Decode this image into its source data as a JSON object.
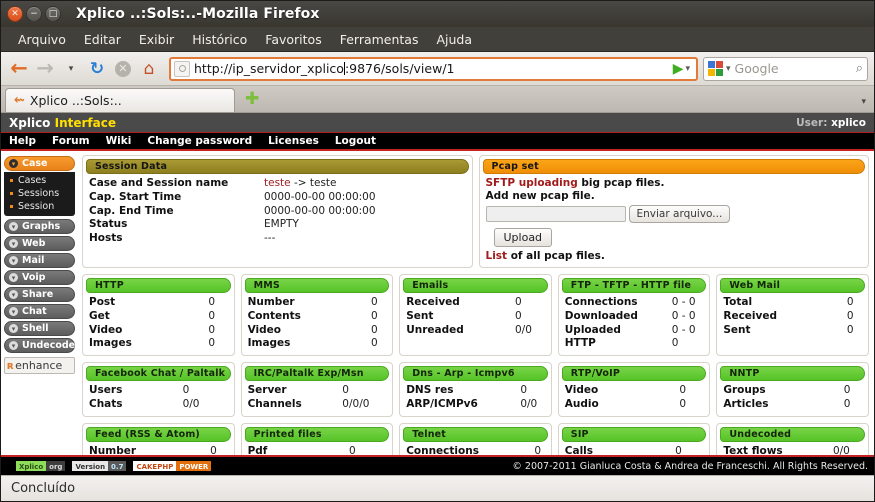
{
  "window": {
    "title": "Xplico ..:Sols:..-Mozilla Firefox",
    "close_glyph": "✕",
    "minimize_glyph": "−",
    "maximize_glyph": "□"
  },
  "menubar": [
    {
      "label": "Arquivo",
      "accel": "A"
    },
    {
      "label": "Editar",
      "accel": "E"
    },
    {
      "label": "Exibir",
      "accel": "x"
    },
    {
      "label": "Histórico",
      "accel": "H"
    },
    {
      "label": "Favoritos",
      "accel": "v"
    },
    {
      "label": "Ferramentas",
      "accel": "F"
    },
    {
      "label": "Ajuda",
      "accel": "u"
    }
  ],
  "toolbar": {
    "back_icon": "back-arrow-icon",
    "forward_icon": "forward-arrow-icon",
    "history_caret": "▾",
    "reload_glyph": "↻",
    "stop_glyph": "✕",
    "home_glyph": "⌂",
    "url": "http://ip_servidor_xplico:9876/sols/view/1",
    "url_before_caret": "http://ip_servidor_xplico",
    "url_after_caret": ":9876/sols/view/1",
    "go_glyph": "▶",
    "url_caret": "▾",
    "search_placeholder": "Google",
    "search_caret": "▾",
    "search_glyph": "⌕"
  },
  "tabbar": {
    "tab_label": "Xplico ..:Sols:..",
    "tab_icon_glyph": "✆",
    "new_tab_glyph": "✚",
    "list_caret": "▾"
  },
  "xplico": {
    "logo_main": "Xplico",
    "logo_accent": "Interface",
    "user_label": "User:",
    "user_name": "xplico",
    "menu": [
      "Help",
      "Forum",
      "Wiki",
      "Change password",
      "Licenses",
      "Logout"
    ]
  },
  "sidebar": {
    "case_group": {
      "label": "Case",
      "bullet": "▾",
      "items": [
        "Cases",
        "Sessions",
        "Session"
      ]
    },
    "items": [
      {
        "label": "Graphs",
        "bullet": "▾"
      },
      {
        "label": "Web",
        "bullet": "▾"
      },
      {
        "label": "Mail",
        "bullet": "▾"
      },
      {
        "label": "Voip",
        "bullet": "▾"
      },
      {
        "label": "Share",
        "bullet": "▾"
      },
      {
        "label": "Chat",
        "bullet": "▾"
      },
      {
        "label": "Shell",
        "bullet": "▾"
      },
      {
        "label": "Undecoded",
        "bullet": "▾"
      }
    ],
    "enhance": {
      "icon": "ʀ",
      "label": "enhance"
    }
  },
  "session_data": {
    "title": "Session Data",
    "rows": [
      {
        "key": "Case and Session name",
        "value": "teste -> teste",
        "value_prefix": "teste",
        "value_suffix": " -> teste"
      },
      {
        "key": "Cap. Start Time",
        "value": "0000-00-00 00:00:00"
      },
      {
        "key": "Cap. End Time",
        "value": "0000-00-00 00:00:00"
      },
      {
        "key": "Status",
        "value": "EMPTY"
      },
      {
        "key": "Hosts",
        "value": "---"
      }
    ]
  },
  "pcap_set": {
    "title": "Pcap set",
    "line1_link": "SFTP uploading",
    "line1_rest": " big pcap files.",
    "line2": "Add new pcap file.",
    "file_button": "Enviar arquivo...",
    "upload_button": "Upload",
    "line3_link": "List",
    "line3_rest": " of all pcap files."
  },
  "panels": [
    {
      "title": "HTTP",
      "rows": [
        {
          "key": "Post",
          "value": "0"
        },
        {
          "key": "Get",
          "value": "0"
        },
        {
          "key": "Video",
          "value": "0"
        },
        {
          "key": "Images",
          "value": "0"
        }
      ]
    },
    {
      "title": "MMS",
      "rows": [
        {
          "key": "Number",
          "value": "0"
        },
        {
          "key": "Contents",
          "value": "0"
        },
        {
          "key": "Video",
          "value": "0"
        },
        {
          "key": "Images",
          "value": "0"
        }
      ]
    },
    {
      "title": "Emails",
      "rows": [
        {
          "key": "Received",
          "value": "0"
        },
        {
          "key": "Sent",
          "value": "0"
        },
        {
          "key": "Unreaded",
          "value": "0/0"
        }
      ]
    },
    {
      "title": "FTP - TFTP - HTTP file",
      "rows": [
        {
          "key": "Connections",
          "value": "0 - 0"
        },
        {
          "key": "Downloaded",
          "value": "0 - 0"
        },
        {
          "key": "Uploaded",
          "value": "0 - 0"
        },
        {
          "key": "HTTP",
          "value": "0"
        }
      ]
    },
    {
      "title": "Web Mail",
      "rows": [
        {
          "key": "Total",
          "value": "0"
        },
        {
          "key": "Received",
          "value": "0"
        },
        {
          "key": "Sent",
          "value": "0"
        }
      ]
    },
    {
      "title": "Facebook Chat / Paltalk",
      "rows": [
        {
          "key": "Users",
          "value": "0"
        },
        {
          "key": "Chats",
          "value": "0/0"
        }
      ]
    },
    {
      "title": "IRC/Paltalk Exp/Msn",
      "rows": [
        {
          "key": "Server",
          "value": "0"
        },
        {
          "key": "Channels",
          "value": "0/0/0"
        }
      ]
    },
    {
      "title": "Dns - Arp - Icmpv6",
      "rows": [
        {
          "key": "DNS res",
          "value": "0"
        },
        {
          "key": "ARP/ICMPv6",
          "value": "0/0"
        }
      ]
    },
    {
      "title": "RTP/VoIP",
      "rows": [
        {
          "key": "Video",
          "value": "0"
        },
        {
          "key": "Audio",
          "value": "0"
        }
      ]
    },
    {
      "title": "NNTP",
      "rows": [
        {
          "key": "Groups",
          "value": "0"
        },
        {
          "key": "Articles",
          "value": "0"
        }
      ]
    },
    {
      "title": "Feed (RSS & Atom)",
      "rows": [
        {
          "key": "Number",
          "value": "0"
        }
      ]
    },
    {
      "title": "Printed files",
      "rows": [
        {
          "key": "Pdf",
          "value": "0"
        }
      ]
    },
    {
      "title": "Telnet",
      "rows": [
        {
          "key": "Connections",
          "value": "0"
        }
      ]
    },
    {
      "title": "SIP",
      "rows": [
        {
          "key": "Calls",
          "value": "0"
        }
      ]
    },
    {
      "title": "Undecoded",
      "rows": [
        {
          "key": "Text flows",
          "value": "0/0"
        }
      ]
    }
  ],
  "footer": {
    "badge_xplico_left": "Xplico",
    "badge_xplico_right": "org",
    "badge_version_left": "Version",
    "badge_version_right": "0.7",
    "badge_cake_left": "CAKEPHP",
    "badge_cake_right": "POWER",
    "copyright": "© 2007-2011 Gianluca Costa & Andrea de Franceschi. All Rights Reserved."
  },
  "statusbar": {
    "text": "Concluído"
  },
  "colors": {
    "accent_orange": "#ef8e06",
    "panel_green": "#56c327",
    "panel_olive": "#8d7e1f",
    "red_rule": "#c52323",
    "link_red": "#a21b1b"
  }
}
